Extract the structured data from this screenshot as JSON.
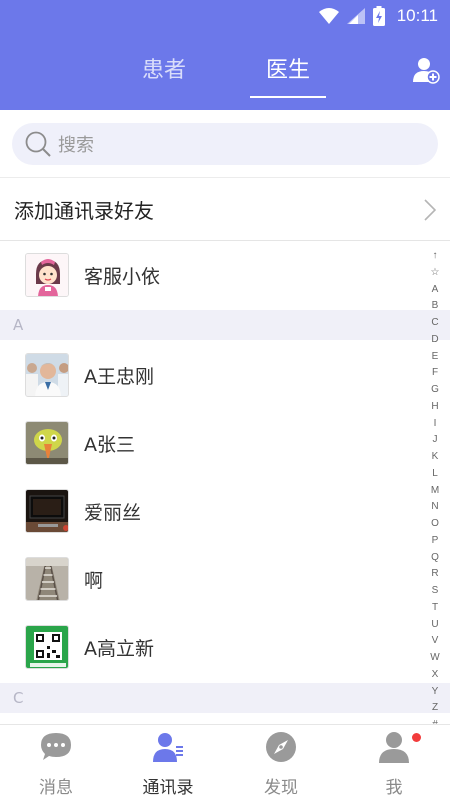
{
  "status_bar": {
    "time": "10:11"
  },
  "header": {
    "tabs": [
      {
        "label": "患者",
        "active": false
      },
      {
        "label": "医生",
        "active": true
      }
    ]
  },
  "search": {
    "placeholder": "搜索"
  },
  "add_friends": {
    "label": "添加通讯录好友"
  },
  "pinned_contact": {
    "name": "客服小依",
    "avatar": "cartoon-girl-avatar"
  },
  "sections": [
    {
      "letter": "A",
      "contacts": [
        {
          "name": "A王忠刚",
          "avatar": "doctors-photo-avatar"
        },
        {
          "name": "A张三",
          "avatar": "yellow-bird-avatar"
        },
        {
          "name": "爱丽丝",
          "avatar": "computer-monitor-avatar"
        },
        {
          "name": "啊",
          "avatar": "railway-tracks-avatar"
        },
        {
          "name": "A高立新",
          "avatar": "qr-code-avatar"
        }
      ]
    },
    {
      "letter": "C",
      "contacts": []
    }
  ],
  "index_letters": [
    "↑",
    "☆",
    "A",
    "B",
    "C",
    "D",
    "E",
    "F",
    "G",
    "H",
    "I",
    "J",
    "K",
    "L",
    "M",
    "N",
    "O",
    "P",
    "Q",
    "R",
    "S",
    "T",
    "U",
    "V",
    "W",
    "X",
    "Y",
    "Z",
    "#"
  ],
  "bottom_tabs": [
    {
      "label": "消息",
      "icon": "chat-bubble-icon",
      "active": false
    },
    {
      "label": "通讯录",
      "icon": "contacts-icon",
      "active": true
    },
    {
      "label": "发现",
      "icon": "compass-icon",
      "active": false
    },
    {
      "label": "我",
      "icon": "person-icon",
      "active": false,
      "badge": true
    }
  ],
  "colors": {
    "primary": "#6c78ea",
    "badge": "#f23c3c",
    "section_bg": "#f0f0f8"
  }
}
